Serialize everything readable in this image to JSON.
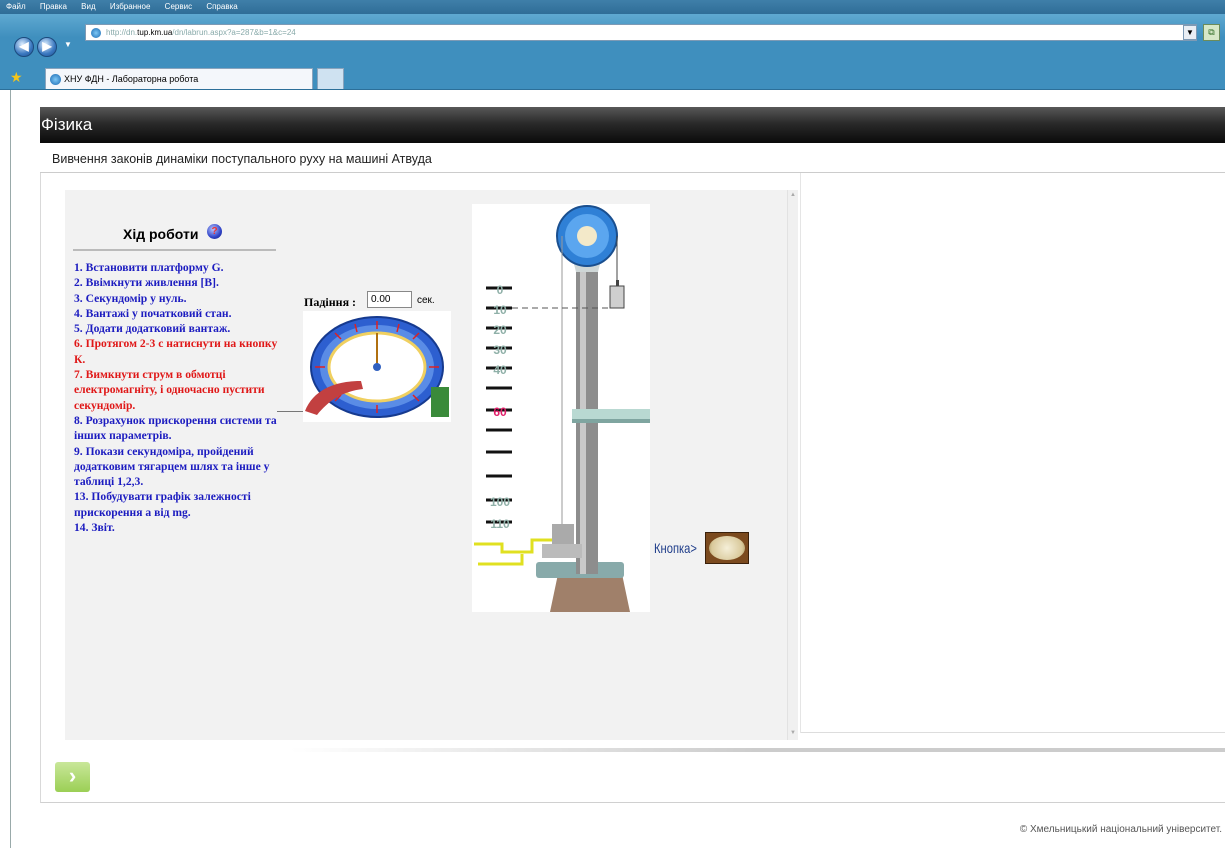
{
  "browser": {
    "menu": [
      "Файл",
      "Правка",
      "Вид",
      "Избранное",
      "Сервис",
      "Справка"
    ],
    "url_prefix": "http://dn.",
    "url_host": "tup.km.ua",
    "url_path": "/dn/labrun.aspx?a=287&b=1&c=24",
    "tab_title": "ХНУ ФДН - Лабораторна робота"
  },
  "header": {
    "course": "Фізика",
    "lab_title": "Вивчення законів динаміки поступального руху на машині Атвуда"
  },
  "lab": {
    "steps_title": "Хід роботи",
    "steps": [
      {
        "text": "1. Встановити платформу G.",
        "color": "blue"
      },
      {
        "text": "2. Ввімкнути живлення [В].",
        "color": "blue"
      },
      {
        "text": "3. Секундомір у нуль.",
        "color": "blue"
      },
      {
        "text": "4. Вантажі у початковий стан.",
        "color": "blue"
      },
      {
        "text": "5. Додати додатковий вантаж.",
        "color": "blue"
      },
      {
        "text": "6. Протягом 2-3 с натиснути на кнопку К.",
        "color": "red"
      },
      {
        "text": "7. Вимкнути струм в обмотці електромагніту, і одночасно пустити секундомір.",
        "color": "red"
      },
      {
        "text": "8. Розрахунок прискорення системи та інших параметрів.",
        "color": "blue"
      },
      {
        "text": "9. Покази секундоміра, пройдений додатковим тягарцем шлях та інше у таблиці 1,2,3.",
        "color": "blue"
      },
      {
        "text": "13. Побудувати графік залежності прискорення а від mg.",
        "color": "blue"
      },
      {
        "text": "14. Звіт.",
        "color": "blue"
      }
    ],
    "fall_label": "Падіння :",
    "fall_value": "0.00",
    "fall_unit": "сек.",
    "scale_marks": [
      "0",
      "10",
      "20",
      "30",
      "40",
      "",
      "60",
      "",
      "",
      "",
      "100",
      "110"
    ],
    "button_label": "Кнопка>"
  },
  "footer": {
    "copyright": "© Хмельницький національний університет."
  },
  "colors": {
    "step_blue": "#1c1cc0",
    "step_red": "#e01818",
    "course_bar": "#111111",
    "next_button": "#9bcf55"
  }
}
